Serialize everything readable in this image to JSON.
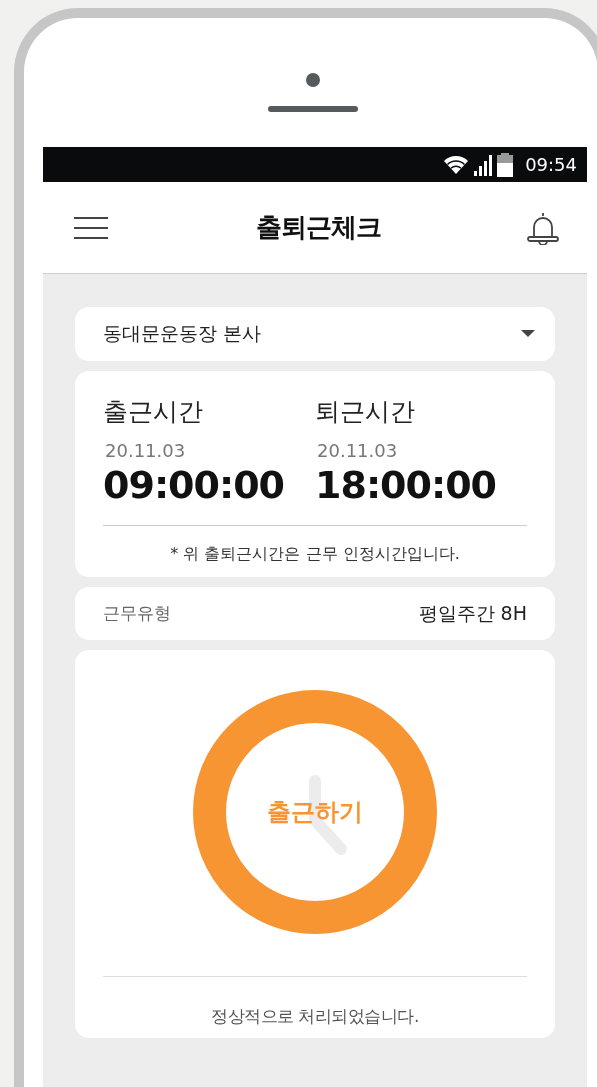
{
  "status_bar": {
    "time": "09:54"
  },
  "header": {
    "title": "출퇴근체크"
  },
  "location_select": {
    "value": "동대문운동장 본사"
  },
  "times": [
    {
      "label": "출근시간",
      "date": "20.11.03",
      "time": "09:00:00"
    },
    {
      "label": "퇴근시간",
      "date": "20.11.03",
      "time": "18:00:00"
    }
  ],
  "note": "* 위 출퇴근시간은 근무 인정시간입니다.",
  "work_type": {
    "label": "근무유형",
    "value": "평일주간 8H"
  },
  "check_button": {
    "label": "출근하기"
  },
  "status_message": "정상적으로 처리되었습니다."
}
